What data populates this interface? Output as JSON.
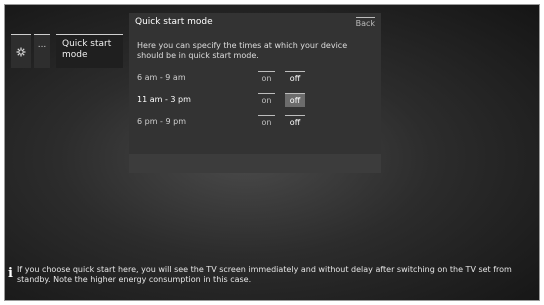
{
  "icons": {
    "settings": "gear-icon",
    "more": "ellipsis-icon",
    "info": "info-icon"
  },
  "nav": {
    "dots": "...",
    "crumb": "Quick start mode"
  },
  "dialog": {
    "title": "Quick start mode",
    "back": "Back",
    "description": "Here you can specify the times at which your device should be in quick start mode.",
    "rows": [
      {
        "label": "6 am - 9 am",
        "on": "on",
        "off": "off",
        "selected": "off"
      },
      {
        "label": "11 am - 3 pm",
        "on": "on",
        "off": "off",
        "selected": "off"
      },
      {
        "label": "6 pm - 9 pm",
        "on": "on",
        "off": "off",
        "selected": "off"
      }
    ]
  },
  "footer": "If you choose quick start here, you will see the TV screen immediately and without delay after switching on the TV set from standby. Note the higher energy consumption in this case."
}
